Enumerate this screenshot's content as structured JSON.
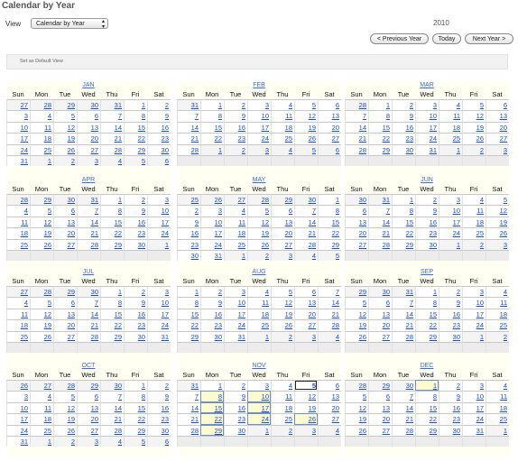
{
  "page": {
    "title": "Calendar by Year",
    "view_label": "View",
    "view_selected": "Calendar by Year",
    "year": "2010",
    "prev_label": "< Previous Year",
    "today_label": "Today",
    "next_label": "Next Year >",
    "default_view_label": "Set as Default View"
  },
  "weekdays": [
    "Sun",
    "Mon",
    "Tue",
    "Wed",
    "Thu",
    "Fri",
    "Sat"
  ],
  "colors": {
    "month_header_bg": "#fffff2",
    "link": "#1a4fc4",
    "selected_week": "#fdfbd0",
    "today_outline": "#222222"
  },
  "months": [
    {
      "name": "JAN",
      "weeks": [
        [
          "27",
          "28",
          "29",
          "30",
          "31",
          "1",
          "2"
        ],
        [
          "3",
          "4",
          "5",
          "6",
          "7",
          "8",
          "9"
        ],
        [
          "10",
          "11",
          "12",
          "13",
          "14",
          "15",
          "16"
        ],
        [
          "17",
          "18",
          "19",
          "20",
          "21",
          "22",
          "23"
        ],
        [
          "24",
          "25",
          "26",
          "27",
          "28",
          "29",
          "30"
        ],
        [
          "31",
          "1",
          "2",
          "3",
          "4",
          "5",
          "6"
        ]
      ],
      "first": 5,
      "days": 31
    },
    {
      "name": "FEB",
      "weeks": [
        [
          "31",
          "1",
          "2",
          "3",
          "4",
          "5",
          "6"
        ],
        [
          "7",
          "8",
          "9",
          "10",
          "11",
          "12",
          "13"
        ],
        [
          "14",
          "15",
          "16",
          "17",
          "18",
          "19",
          "20"
        ],
        [
          "21",
          "22",
          "23",
          "24",
          "25",
          "26",
          "27"
        ],
        [
          "28",
          "1",
          "2",
          "3",
          "4",
          "5",
          "6"
        ],
        [
          "",
          "",
          "",
          "",
          "",
          "",
          ""
        ]
      ],
      "first": 1,
      "days": 28
    },
    {
      "name": "MAR",
      "weeks": [
        [
          "28",
          "1",
          "2",
          "3",
          "4",
          "5",
          "6"
        ],
        [
          "7",
          "8",
          "9",
          "10",
          "11",
          "12",
          "13"
        ],
        [
          "14",
          "15",
          "16",
          "17",
          "18",
          "19",
          "20"
        ],
        [
          "21",
          "22",
          "23",
          "24",
          "25",
          "26",
          "27"
        ],
        [
          "28",
          "29",
          "30",
          "31",
          "1",
          "2",
          "3"
        ],
        [
          "",
          "",
          "",
          "",
          "",
          "",
          ""
        ]
      ],
      "first": 1,
      "days": 31
    },
    {
      "name": "APR",
      "weeks": [
        [
          "28",
          "29",
          "30",
          "31",
          "1",
          "2",
          "3"
        ],
        [
          "4",
          "5",
          "6",
          "7",
          "8",
          "9",
          "10"
        ],
        [
          "11",
          "12",
          "13",
          "14",
          "15",
          "16",
          "17"
        ],
        [
          "18",
          "19",
          "20",
          "21",
          "22",
          "23",
          "24"
        ],
        [
          "25",
          "26",
          "27",
          "28",
          "29",
          "30",
          "1"
        ],
        [
          "",
          "",
          "",
          "",
          "",
          "",
          ""
        ]
      ],
      "first": 4,
      "days": 30
    },
    {
      "name": "MAY",
      "weeks": [
        [
          "25",
          "26",
          "27",
          "28",
          "29",
          "30",
          "1"
        ],
        [
          "2",
          "3",
          "4",
          "5",
          "6",
          "7",
          "8"
        ],
        [
          "9",
          "10",
          "11",
          "12",
          "13",
          "14",
          "15"
        ],
        [
          "16",
          "17",
          "18",
          "19",
          "20",
          "21",
          "22"
        ],
        [
          "23",
          "24",
          "25",
          "26",
          "27",
          "28",
          "29"
        ],
        [
          "30",
          "31",
          "1",
          "2",
          "3",
          "4",
          "5"
        ]
      ],
      "first": 6,
      "days": 31
    },
    {
      "name": "JUN",
      "weeks": [
        [
          "30",
          "31",
          "1",
          "2",
          "3",
          "4",
          "5"
        ],
        [
          "6",
          "7",
          "8",
          "9",
          "10",
          "11",
          "12"
        ],
        [
          "13",
          "14",
          "15",
          "16",
          "17",
          "18",
          "19"
        ],
        [
          "20",
          "21",
          "22",
          "23",
          "24",
          "25",
          "26"
        ],
        [
          "27",
          "28",
          "29",
          "30",
          "1",
          "2",
          "3"
        ],
        [
          "",
          "",
          "",
          "",
          "",
          "",
          ""
        ]
      ],
      "first": 2,
      "days": 30
    },
    {
      "name": "JUL",
      "weeks": [
        [
          "27",
          "28",
          "29",
          "30",
          "1",
          "2",
          "3"
        ],
        [
          "4",
          "5",
          "6",
          "7",
          "8",
          "9",
          "10"
        ],
        [
          "11",
          "12",
          "13",
          "14",
          "15",
          "16",
          "17"
        ],
        [
          "18",
          "19",
          "20",
          "21",
          "22",
          "23",
          "24"
        ],
        [
          "25",
          "26",
          "27",
          "28",
          "29",
          "30",
          "31"
        ],
        [
          "",
          "",
          "",
          "",
          "",
          "",
          ""
        ]
      ],
      "first": 4,
      "days": 31
    },
    {
      "name": "AUG",
      "weeks": [
        [
          "1",
          "2",
          "3",
          "4",
          "5",
          "6",
          "7"
        ],
        [
          "8",
          "9",
          "10",
          "11",
          "12",
          "13",
          "14"
        ],
        [
          "15",
          "16",
          "17",
          "18",
          "19",
          "20",
          "21"
        ],
        [
          "22",
          "23",
          "24",
          "25",
          "26",
          "27",
          "28"
        ],
        [
          "29",
          "30",
          "31",
          "1",
          "2",
          "3",
          "4"
        ],
        [
          "",
          "",
          "",
          "",
          "",
          "",
          ""
        ]
      ],
      "first": 0,
      "days": 31
    },
    {
      "name": "SEP",
      "weeks": [
        [
          "29",
          "30",
          "31",
          "1",
          "2",
          "3",
          "4"
        ],
        [
          "5",
          "6",
          "7",
          "8",
          "9",
          "10",
          "11"
        ],
        [
          "12",
          "13",
          "14",
          "15",
          "16",
          "17",
          "18"
        ],
        [
          "19",
          "20",
          "21",
          "22",
          "23",
          "24",
          "25"
        ],
        [
          "26",
          "27",
          "28",
          "29",
          "30",
          "1",
          "2"
        ],
        [
          "",
          "",
          "",
          "",
          "",
          "",
          ""
        ]
      ],
      "first": 3,
      "days": 30
    },
    {
      "name": "OCT",
      "weeks": [
        [
          "26",
          "27",
          "28",
          "29",
          "30",
          "1",
          "2"
        ],
        [
          "3",
          "4",
          "5",
          "6",
          "7",
          "8",
          "9"
        ],
        [
          "10",
          "11",
          "12",
          "13",
          "14",
          "15",
          "16"
        ],
        [
          "17",
          "18",
          "19",
          "20",
          "21",
          "22",
          "23"
        ],
        [
          "24",
          "25",
          "26",
          "27",
          "28",
          "29",
          "30"
        ],
        [
          "31",
          "1",
          "2",
          "3",
          "4",
          "5",
          "6"
        ]
      ],
      "first": 5,
      "days": 31
    },
    {
      "name": "NOV",
      "weeks": [
        [
          "31",
          "1",
          "2",
          "3",
          "4",
          "5",
          "6"
        ],
        [
          "7",
          "8",
          "9",
          "10",
          "11",
          "12",
          "13"
        ],
        [
          "14",
          "15",
          "16",
          "17",
          "18",
          "19",
          "20"
        ],
        [
          "21",
          "22",
          "23",
          "24",
          "25",
          "26",
          "27"
        ],
        [
          "28",
          "29",
          "30",
          "1",
          "2",
          "3",
          "4"
        ],
        [
          "",
          "",
          "",
          "",
          "",
          "",
          ""
        ]
      ],
      "first": 1,
      "days": 30,
      "today_day": "5",
      "selected_days": [
        "8",
        "10",
        "15",
        "17",
        "22",
        "24",
        "26",
        "29"
      ]
    },
    {
      "name": "DEC",
      "weeks": [
        [
          "28",
          "29",
          "30",
          "1",
          "2",
          "3",
          "4"
        ],
        [
          "5",
          "6",
          "7",
          "8",
          "9",
          "10",
          "11"
        ],
        [
          "12",
          "13",
          "14",
          "15",
          "16",
          "17",
          "18"
        ],
        [
          "19",
          "20",
          "21",
          "22",
          "23",
          "24",
          "25"
        ],
        [
          "26",
          "27",
          "28",
          "29",
          "30",
          "31",
          "1"
        ],
        [
          "",
          "",
          "",
          "",
          "",
          "",
          ""
        ]
      ],
      "first": 3,
      "days": 31,
      "selected_days": [
        "1"
      ]
    }
  ]
}
